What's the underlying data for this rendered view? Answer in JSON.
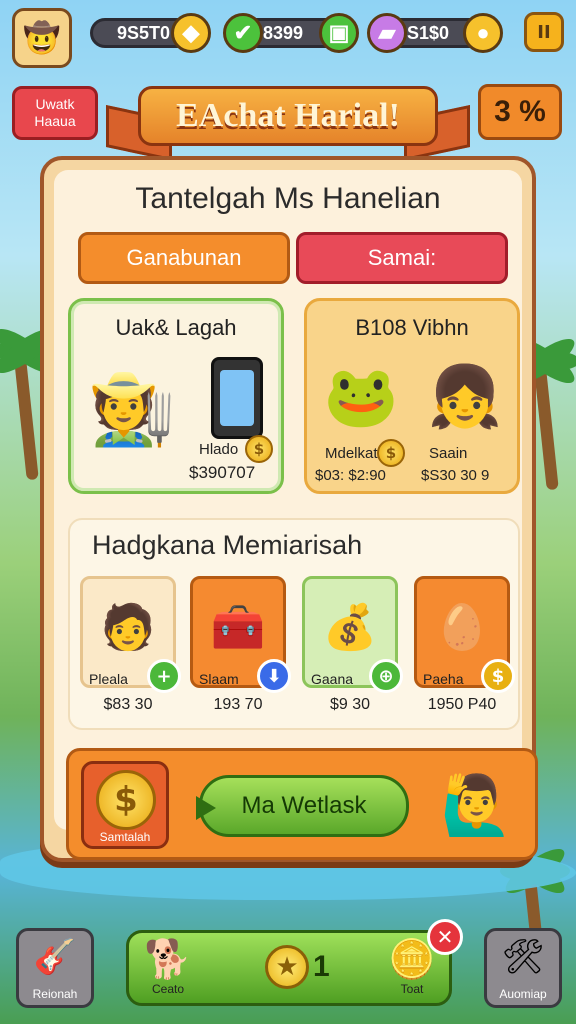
{
  "topbar": {
    "resources": [
      {
        "value": "9S5T0",
        "icon": "coin-icon",
        "color": "#f6c12c"
      },
      {
        "value": "8399",
        "icon": "gem-icon",
        "color": "#4cc23c"
      },
      {
        "value": "S1$0",
        "icon": "crate-icon",
        "color": "#c77be6"
      }
    ],
    "pause_label": "II"
  },
  "side_left": {
    "line1": "Uwatk",
    "line2": "Haaua"
  },
  "side_right": {
    "label": "3 %"
  },
  "banner": {
    "title": "EAchat Harial!"
  },
  "panel": {
    "title": "Tantelgah Ms Hanelian",
    "tabs": [
      {
        "label": "Ganabunan",
        "color": "#f48d2c"
      },
      {
        "label": "Samai:",
        "color": "#e84a58"
      }
    ],
    "featured": [
      {
        "title": "Uak& Lagah",
        "item_label": "Hlado",
        "price": "$390707"
      },
      {
        "title": "B108 Vibhn",
        "item_labels": [
          "Mdelkat",
          "Saain"
        ],
        "prices": [
          "$03: $2:90",
          "$S30 30 9"
        ]
      }
    ]
  },
  "section": {
    "title": "Hadgkana Memiarisah",
    "items": [
      {
        "name": "Pleala",
        "price": "$83 30",
        "badge": "+",
        "badge_color": "#4cb83a",
        "bg": "#fbe9c8",
        "border": "#e6c48e",
        "icon": "person-icon",
        "emoji": "🧑"
      },
      {
        "name": "Slaam",
        "price": "193 70",
        "badge": "⬇",
        "badge_color": "#3a6be8",
        "bg": "#f58a30",
        "border": "#b55a12",
        "icon": "red-crate-icon",
        "emoji": "🧰"
      },
      {
        "name": "Gaana",
        "price": "$9 30",
        "badge": "⊕",
        "badge_color": "#4cb83a",
        "bg": "#d6eeb6",
        "border": "#8cc45a",
        "icon": "money-bag-icon",
        "emoji": "💰"
      },
      {
        "name": "Paeha",
        "price": "1950 Р40",
        "badge": "$",
        "badge_color": "#e8b012",
        "bg": "#f58a30",
        "border": "#b55a12",
        "icon": "egg-icon",
        "emoji": "🥚"
      }
    ]
  },
  "bottom_strip": {
    "coin_label": "Samtalah",
    "coin_symbol": "$",
    "play_label": "Ma Wetlask"
  },
  "bottom_nav": {
    "left_label": "Reionah",
    "center_left_label": "Ceato",
    "center_star_count": "1",
    "center_right_label": "Toat",
    "right_label": "Auomiap"
  }
}
